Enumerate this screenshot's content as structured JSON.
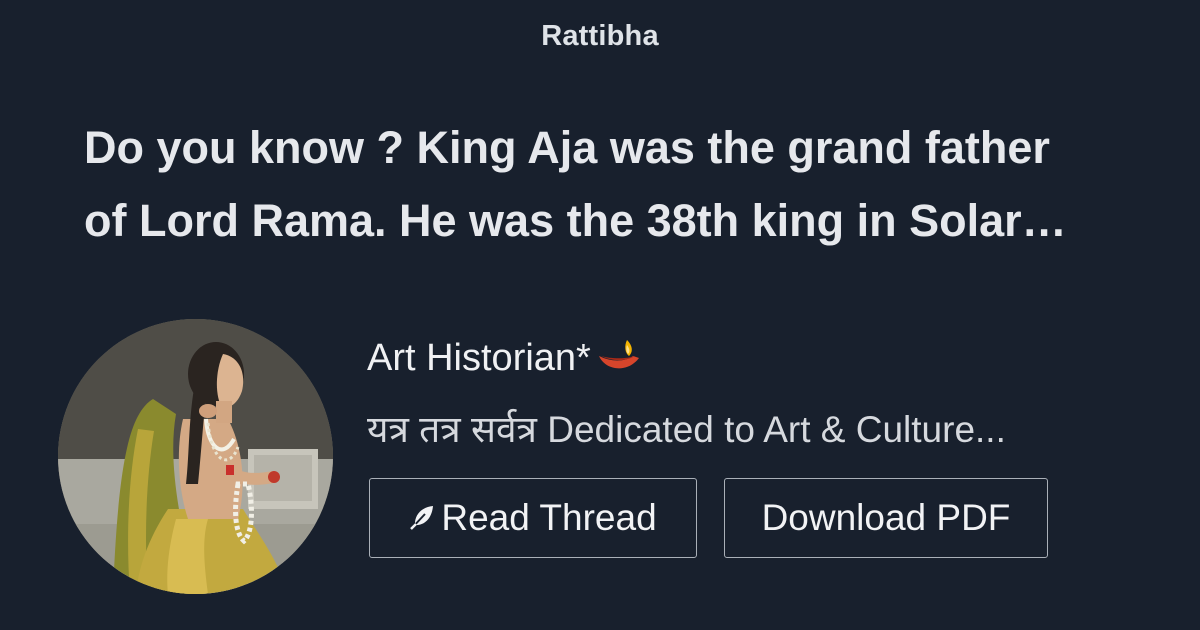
{
  "site": {
    "name": "Rattibha"
  },
  "thread": {
    "title_line1": "Do you know ? King Aja was the grand father",
    "title_line2": "of Lord Rama. He was the 38th king in Solar…"
  },
  "author": {
    "name": "Art Historian*",
    "name_emoji_icon": "diya-lamp-icon",
    "bio": "यत्र तत्र सर्वत्र Dedicated to Art & Culture..."
  },
  "actions": {
    "read_label": "Read Thread",
    "read_icon": "feather-icon",
    "pdf_label": "Download PDF"
  },
  "colors": {
    "background": "#18202d",
    "text": "#e6e8ec",
    "button_border": "#aab0b8"
  }
}
